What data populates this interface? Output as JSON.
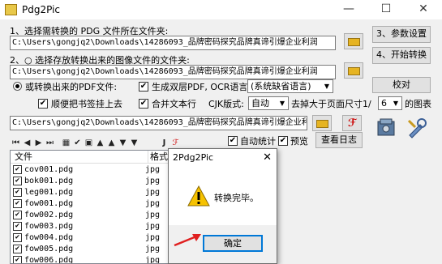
{
  "window": {
    "title": "Pdg2Pic",
    "minimize": "—",
    "maximize": "☐",
    "close": "✕"
  },
  "step1": {
    "label": "1、选择需转换的 PDG 文件所在文件夹:",
    "path": "C:\\Users\\gongjq2\\Downloads\\14286093_品牌密码探究品牌真谛引爆企业利润"
  },
  "step2": {
    "label": "2、○ 选择存放转换出来的图像文件的文件夹:",
    "path": "C:\\Users\\gongjq2\\Downloads\\14286093_品牌密码探究品牌真谛引爆企业利润"
  },
  "options": {
    "pdf_radio": "或转换出来的PDF文件:",
    "ocr_check": "生成双层PDF, OCR语言:",
    "ocr_select": "(系统缺省语言)",
    "bookmark_check": "顺便把书签挂上去",
    "merge_check": "合并文本行",
    "cjk_label": "CJK版式:",
    "cjk_select": "自动",
    "remove_label": "去掉大于页面尺寸1/",
    "remove_select": "6",
    "remove_suffix": "的图表"
  },
  "buttons": {
    "params": "3、参数设置",
    "start": "4、开始转换",
    "verify": "校对",
    "log": "查看日志",
    "folder_icon": "folder-icon"
  },
  "pdf_path": "C:\\Users\\gongjq2\\Downloads\\14286093_品牌密码探究品牌真谛引爆企业利",
  "toolbar": {
    "icons": [
      "⏮",
      "◀",
      "▶",
      "⏭",
      "▦",
      "✔",
      "▣",
      "▲",
      "▲",
      "▼",
      "▼",
      "J",
      "ℱ"
    ],
    "auto_stats": "自动统计",
    "preview": "预览"
  },
  "file_list": {
    "columns": [
      "文件",
      "格式"
    ],
    "rows": [
      {
        "name": "cov001.pdg",
        "ext": "jpg"
      },
      {
        "name": "bok001.pdg",
        "ext": "jpg"
      },
      {
        "name": "leg001.pdg",
        "ext": "jpg"
      },
      {
        "name": "fow001.pdg",
        "ext": "jpg"
      },
      {
        "name": "fow002.pdg",
        "ext": "jpg"
      },
      {
        "name": "fow003.pdg",
        "ext": "jpg"
      },
      {
        "name": "fow004.pdg",
        "ext": "jpg"
      },
      {
        "name": "fow005.pdg",
        "ext": "jpg"
      },
      {
        "name": "fow006.pdg",
        "ext": "jpg"
      }
    ]
  },
  "dialog": {
    "title": "2Pdg2Pic",
    "close": "✕",
    "message": "转换完毕。",
    "ok": "确定"
  }
}
